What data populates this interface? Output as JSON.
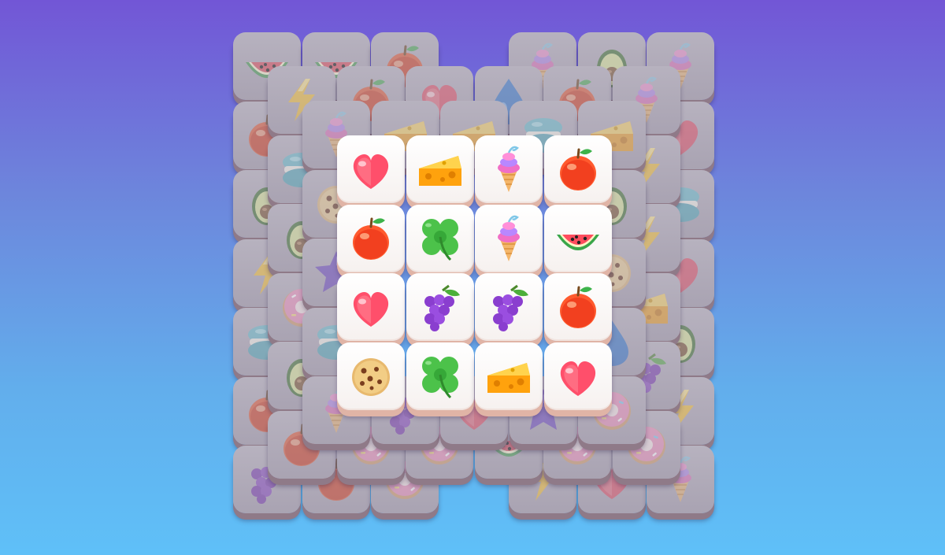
{
  "game": {
    "board": {
      "layers": [
        {
          "level": 0,
          "state": "covered",
          "tiles": [
            [
              "watermelon",
              "watermelon",
              "apple",
              null,
              "icecream",
              "avocado",
              "icecream"
            ],
            [
              "apple",
              null,
              null,
              null,
              null,
              null,
              "heart"
            ],
            [
              "avocado",
              null,
              null,
              null,
              null,
              null,
              "macaron"
            ],
            [
              "lightning",
              null,
              null,
              null,
              null,
              null,
              "heart"
            ],
            [
              "macaron",
              null,
              null,
              null,
              null,
              null,
              "avocado"
            ],
            [
              "apple",
              null,
              null,
              null,
              null,
              null,
              "lightning"
            ],
            [
              "grapes",
              "apple",
              "donut",
              null,
              "lightning",
              "heart",
              "icecream"
            ]
          ]
        },
        {
          "level": 1,
          "state": "covered",
          "tiles": [
            [
              "lightning",
              "apple",
              "heart",
              "drop",
              "apple",
              "icecream"
            ],
            [
              "macaron",
              null,
              null,
              null,
              null,
              "lightning"
            ],
            [
              "avocado",
              null,
              null,
              null,
              null,
              "lightning"
            ],
            [
              "donut",
              null,
              null,
              null,
              null,
              "cheese"
            ],
            [
              "avocado",
              null,
              null,
              null,
              null,
              "grapes"
            ],
            [
              "apple",
              "donut",
              "donut",
              "watermelon",
              "donut",
              "donut"
            ]
          ]
        },
        {
          "level": 2,
          "state": "covered",
          "tiles": [
            [
              "icecream",
              "cheese",
              "cheese",
              "macaron",
              "cheese"
            ],
            [
              "cookie",
              null,
              null,
              null,
              "avocado"
            ],
            [
              "star",
              null,
              null,
              null,
              "cookie"
            ],
            [
              "macaron",
              null,
              null,
              null,
              "drop"
            ],
            [
              "icecream",
              "grapes",
              "heart",
              "star",
              "donut"
            ]
          ]
        },
        {
          "level": 3,
          "state": "free",
          "tiles": [
            [
              "heart",
              "cheese",
              "icecream",
              "apple"
            ],
            [
              "apple",
              "clover",
              "icecream",
              "watermelon"
            ],
            [
              "heart",
              "grapes",
              "grapes",
              "apple"
            ],
            [
              "cookie",
              "clover",
              "cheese",
              "heart"
            ]
          ]
        }
      ]
    },
    "colors": {
      "tile_face": "#ffffff",
      "tile_edge": "#e0b4a6",
      "tile_dim": "#b1abb9",
      "background_top": "#7256d6",
      "background_bottom": "#5fc0f8"
    }
  }
}
